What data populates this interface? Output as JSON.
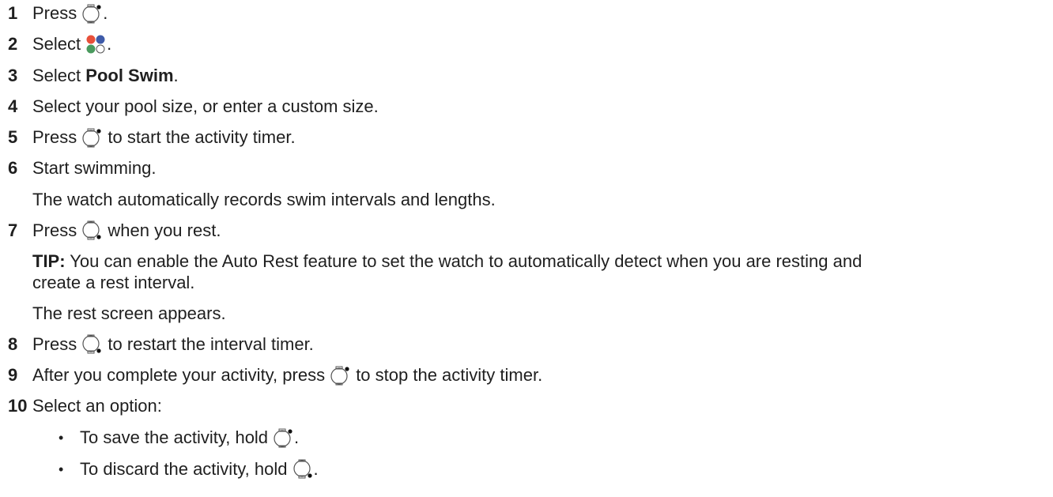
{
  "steps": [
    {
      "num": "1",
      "parts": {
        "a": "Press",
        "b": "."
      }
    },
    {
      "num": "2",
      "parts": {
        "a": "Select",
        "b": "."
      }
    },
    {
      "num": "3",
      "parts": {
        "a": "Select ",
        "bold": "Pool Swim",
        "b": "."
      }
    },
    {
      "num": "4",
      "parts": {
        "a": "Select your pool size, or enter a custom size."
      }
    },
    {
      "num": "5",
      "parts": {
        "a": "Press",
        "b": " to start the activity timer."
      }
    },
    {
      "num": "6",
      "parts": {
        "a": "Start swimming."
      }
    },
    {
      "num": "7",
      "parts": {
        "a": "Press",
        "b": " when you rest."
      }
    },
    {
      "num": "8",
      "parts": {
        "a": "Press",
        "b": " to restart the interval timer."
      }
    },
    {
      "num": "9",
      "parts": {
        "a": "After you complete your activity, press",
        "b": " to stop the activity timer."
      }
    },
    {
      "num": "10",
      "parts": {
        "a": "Select an option:"
      }
    }
  ],
  "notes": {
    "step6": "The watch automatically records swim intervals and lengths.",
    "tip_label": "TIP:",
    "tip_line1": " You can enable the Auto Rest feature to set the watch to automatically detect when you are resting and",
    "tip_line2": "create a rest interval.",
    "rest_screen": "The rest screen appears."
  },
  "options": [
    {
      "bullet": "•",
      "a": "To save the activity, hold",
      "b": "."
    },
    {
      "bullet": "•",
      "a": "To discard the activity, hold",
      "b": "."
    }
  ],
  "icons": {
    "start_stop": "watch-button-top-right-icon",
    "activities": "activity-colors-icon",
    "lap": "watch-button-bottom-right-icon"
  },
  "colors": {
    "red": "#e8503a",
    "blue": "#3e5ba9",
    "green": "#4a9a5e",
    "text": "#1f1f1f"
  }
}
